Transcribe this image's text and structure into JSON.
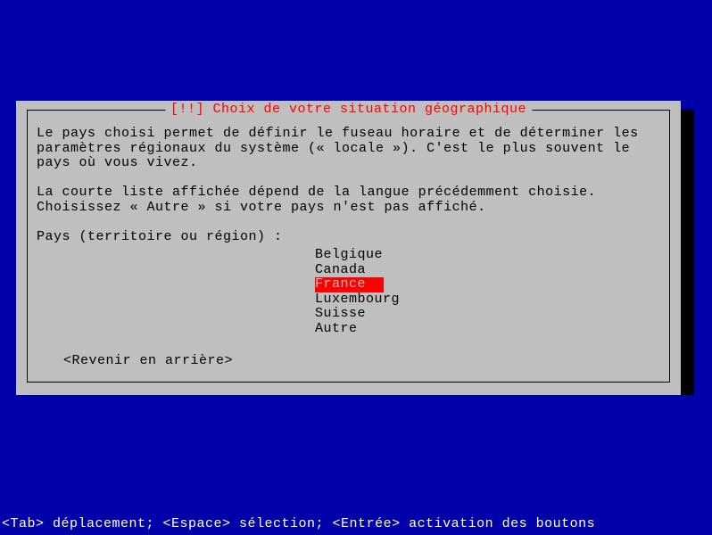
{
  "dialog": {
    "title": "[!!] Choix de votre situation géographique",
    "paragraph1": "Le pays choisi permet de définir le fuseau horaire et de déterminer les paramètres régionaux du système (« locale »). C'est le plus souvent le pays où vous vivez.",
    "paragraph2": "La courte liste affichée dépend de la langue précédemment choisie. Choisissez « Autre » si votre pays n'est pas affiché.",
    "prompt": "Pays (territoire ou région) :",
    "options": {
      "0": "Belgique",
      "1": "Canada",
      "2": "France",
      "3": "Luxembourg",
      "4": "Suisse",
      "5": "Autre"
    },
    "back": "<Revenir en arrière>"
  },
  "footer": "<Tab> déplacement; <Espace> sélection; <Entrée> activation des boutons"
}
